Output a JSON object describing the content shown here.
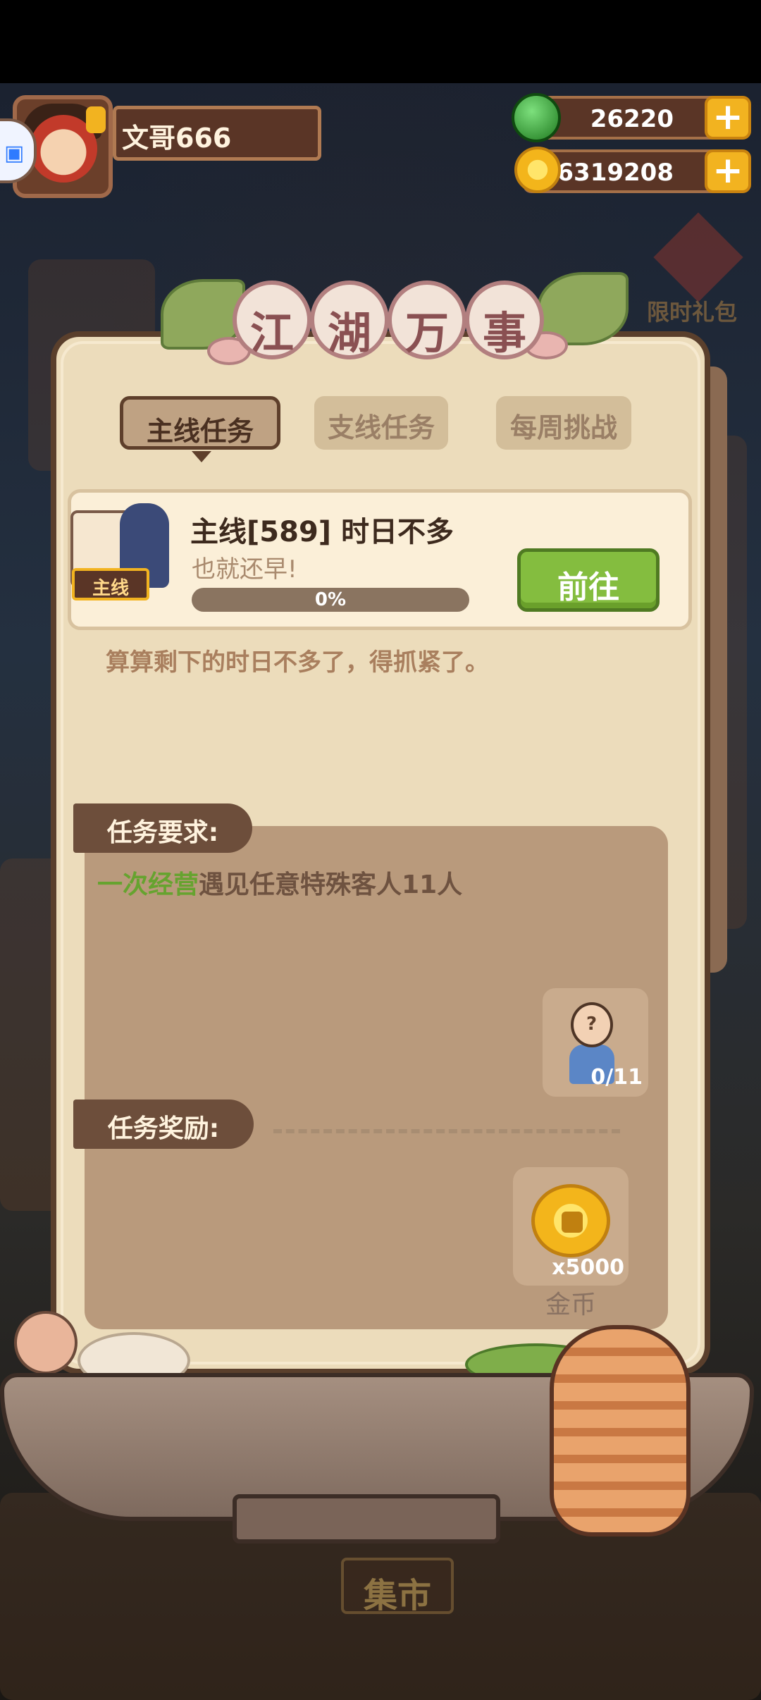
{
  "player": {
    "name": "文哥666"
  },
  "resources": {
    "jade": {
      "value": "26220",
      "color": "#2f9a2f",
      "icon": "jade-orb-icon"
    },
    "coins": {
      "value": "26319208",
      "color": "#f3b51b",
      "icon": "coin-icon"
    }
  },
  "side_chip": {
    "icon": "app-shortcut-icon"
  },
  "gift": {
    "label": "限时礼包"
  },
  "panel": {
    "title_chars": [
      "江",
      "湖",
      "万",
      "事"
    ],
    "tabs": [
      {
        "label": "主线任务",
        "active": true
      },
      {
        "label": "支线任务",
        "active": false
      },
      {
        "label": "每周挑战",
        "active": false
      }
    ],
    "task": {
      "tag": "主线",
      "title": "主线[589] 时日不多",
      "subtitle": "也就还早!",
      "progress": 0,
      "progress_label": "0%",
      "go_button": "前往"
    },
    "description": "算算剩下的时日不多了，得抓紧了。",
    "requirement": {
      "label": "任务要求:",
      "highlight": "一次经营",
      "text": "遇见任意特殊客人11人",
      "counter": "0/11"
    },
    "reward": {
      "label": "任务奖励:",
      "quantity": "x5000",
      "name": "金币"
    }
  },
  "bottom": {
    "market_sign": "集市"
  },
  "colors": {
    "panel_bg": "#ecdcbb",
    "panel_border": "#5a3f2c",
    "go_button": "#84bd3f",
    "highlight_green": "#66a32f"
  }
}
